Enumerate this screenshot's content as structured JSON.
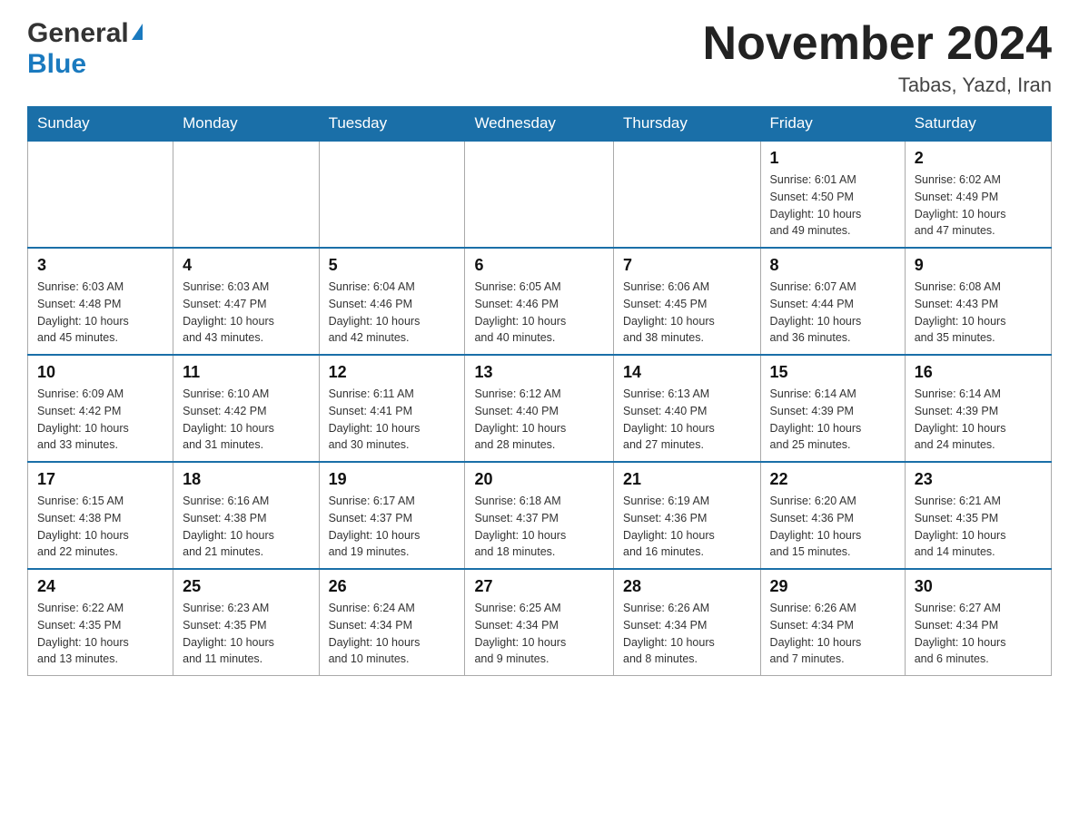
{
  "header": {
    "logo_general": "General",
    "logo_blue": "Blue",
    "title": "November 2024",
    "location": "Tabas, Yazd, Iran"
  },
  "days_of_week": [
    "Sunday",
    "Monday",
    "Tuesday",
    "Wednesday",
    "Thursday",
    "Friday",
    "Saturday"
  ],
  "weeks": [
    {
      "days": [
        {
          "number": "",
          "info": ""
        },
        {
          "number": "",
          "info": ""
        },
        {
          "number": "",
          "info": ""
        },
        {
          "number": "",
          "info": ""
        },
        {
          "number": "",
          "info": ""
        },
        {
          "number": "1",
          "info": "Sunrise: 6:01 AM\nSunset: 4:50 PM\nDaylight: 10 hours\nand 49 minutes."
        },
        {
          "number": "2",
          "info": "Sunrise: 6:02 AM\nSunset: 4:49 PM\nDaylight: 10 hours\nand 47 minutes."
        }
      ]
    },
    {
      "days": [
        {
          "number": "3",
          "info": "Sunrise: 6:03 AM\nSunset: 4:48 PM\nDaylight: 10 hours\nand 45 minutes."
        },
        {
          "number": "4",
          "info": "Sunrise: 6:03 AM\nSunset: 4:47 PM\nDaylight: 10 hours\nand 43 minutes."
        },
        {
          "number": "5",
          "info": "Sunrise: 6:04 AM\nSunset: 4:46 PM\nDaylight: 10 hours\nand 42 minutes."
        },
        {
          "number": "6",
          "info": "Sunrise: 6:05 AM\nSunset: 4:46 PM\nDaylight: 10 hours\nand 40 minutes."
        },
        {
          "number": "7",
          "info": "Sunrise: 6:06 AM\nSunset: 4:45 PM\nDaylight: 10 hours\nand 38 minutes."
        },
        {
          "number": "8",
          "info": "Sunrise: 6:07 AM\nSunset: 4:44 PM\nDaylight: 10 hours\nand 36 minutes."
        },
        {
          "number": "9",
          "info": "Sunrise: 6:08 AM\nSunset: 4:43 PM\nDaylight: 10 hours\nand 35 minutes."
        }
      ]
    },
    {
      "days": [
        {
          "number": "10",
          "info": "Sunrise: 6:09 AM\nSunset: 4:42 PM\nDaylight: 10 hours\nand 33 minutes."
        },
        {
          "number": "11",
          "info": "Sunrise: 6:10 AM\nSunset: 4:42 PM\nDaylight: 10 hours\nand 31 minutes."
        },
        {
          "number": "12",
          "info": "Sunrise: 6:11 AM\nSunset: 4:41 PM\nDaylight: 10 hours\nand 30 minutes."
        },
        {
          "number": "13",
          "info": "Sunrise: 6:12 AM\nSunset: 4:40 PM\nDaylight: 10 hours\nand 28 minutes."
        },
        {
          "number": "14",
          "info": "Sunrise: 6:13 AM\nSunset: 4:40 PM\nDaylight: 10 hours\nand 27 minutes."
        },
        {
          "number": "15",
          "info": "Sunrise: 6:14 AM\nSunset: 4:39 PM\nDaylight: 10 hours\nand 25 minutes."
        },
        {
          "number": "16",
          "info": "Sunrise: 6:14 AM\nSunset: 4:39 PM\nDaylight: 10 hours\nand 24 minutes."
        }
      ]
    },
    {
      "days": [
        {
          "number": "17",
          "info": "Sunrise: 6:15 AM\nSunset: 4:38 PM\nDaylight: 10 hours\nand 22 minutes."
        },
        {
          "number": "18",
          "info": "Sunrise: 6:16 AM\nSunset: 4:38 PM\nDaylight: 10 hours\nand 21 minutes."
        },
        {
          "number": "19",
          "info": "Sunrise: 6:17 AM\nSunset: 4:37 PM\nDaylight: 10 hours\nand 19 minutes."
        },
        {
          "number": "20",
          "info": "Sunrise: 6:18 AM\nSunset: 4:37 PM\nDaylight: 10 hours\nand 18 minutes."
        },
        {
          "number": "21",
          "info": "Sunrise: 6:19 AM\nSunset: 4:36 PM\nDaylight: 10 hours\nand 16 minutes."
        },
        {
          "number": "22",
          "info": "Sunrise: 6:20 AM\nSunset: 4:36 PM\nDaylight: 10 hours\nand 15 minutes."
        },
        {
          "number": "23",
          "info": "Sunrise: 6:21 AM\nSunset: 4:35 PM\nDaylight: 10 hours\nand 14 minutes."
        }
      ]
    },
    {
      "days": [
        {
          "number": "24",
          "info": "Sunrise: 6:22 AM\nSunset: 4:35 PM\nDaylight: 10 hours\nand 13 minutes."
        },
        {
          "number": "25",
          "info": "Sunrise: 6:23 AM\nSunset: 4:35 PM\nDaylight: 10 hours\nand 11 minutes."
        },
        {
          "number": "26",
          "info": "Sunrise: 6:24 AM\nSunset: 4:34 PM\nDaylight: 10 hours\nand 10 minutes."
        },
        {
          "number": "27",
          "info": "Sunrise: 6:25 AM\nSunset: 4:34 PM\nDaylight: 10 hours\nand 9 minutes."
        },
        {
          "number": "28",
          "info": "Sunrise: 6:26 AM\nSunset: 4:34 PM\nDaylight: 10 hours\nand 8 minutes."
        },
        {
          "number": "29",
          "info": "Sunrise: 6:26 AM\nSunset: 4:34 PM\nDaylight: 10 hours\nand 7 minutes."
        },
        {
          "number": "30",
          "info": "Sunrise: 6:27 AM\nSunset: 4:34 PM\nDaylight: 10 hours\nand 6 minutes."
        }
      ]
    }
  ]
}
